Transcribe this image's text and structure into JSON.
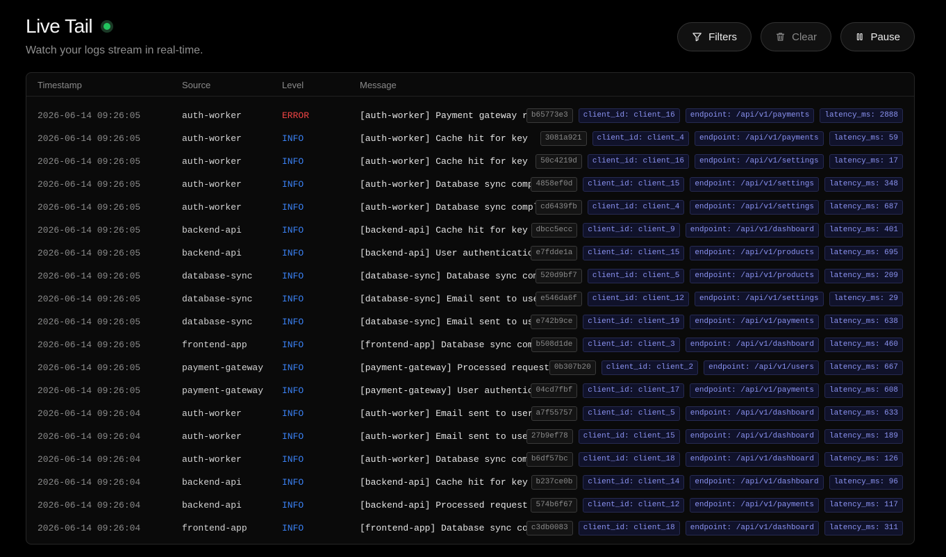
{
  "header": {
    "title": "Live Tail",
    "subtitle": "Watch your logs stream in real-time."
  },
  "actions": {
    "filters": "Filters",
    "clear": "Clear",
    "pause": "Pause"
  },
  "icons": {
    "filters": "funnel-icon",
    "clear": "trash-icon",
    "pause": "pause-icon",
    "status": "live-status-dot"
  },
  "colors": {
    "live": "#22c55e",
    "info": "#3b82f6",
    "error": "#ef4444",
    "tag": "#8b93f2"
  },
  "table": {
    "columns": [
      "Timestamp",
      "Source",
      "Level",
      "Message"
    ],
    "rows": [
      {
        "ts": "2026-06-14 09:26:05",
        "source": "auth-worker",
        "level": "ERROR",
        "message": "[auth-worker] Payment gateway rej…",
        "id": "b65773e3",
        "client": "client_id: client_16",
        "endpoint": "endpoint: /api/v1/payments",
        "latency": "latency_ms: 2888"
      },
      {
        "ts": "2026-06-14 09:26:05",
        "source": "auth-worker",
        "level": "INFO",
        "message": "[auth-worker] Cache hit for key",
        "id": "3081a921",
        "client": "client_id: client_4",
        "endpoint": "endpoint: /api/v1/payments",
        "latency": "latency_ms: 59"
      },
      {
        "ts": "2026-06-14 09:26:05",
        "source": "auth-worker",
        "level": "INFO",
        "message": "[auth-worker] Cache hit for key",
        "id": "50c4219d",
        "client": "client_id: client_16",
        "endpoint": "endpoint: /api/v1/settings",
        "latency": "latency_ms: 17"
      },
      {
        "ts": "2026-06-14 09:26:05",
        "source": "auth-worker",
        "level": "INFO",
        "message": "[auth-worker] Database sync compl…",
        "id": "4858ef0d",
        "client": "client_id: client_15",
        "endpoint": "endpoint: /api/v1/settings",
        "latency": "latency_ms: 348"
      },
      {
        "ts": "2026-06-14 09:26:05",
        "source": "auth-worker",
        "level": "INFO",
        "message": "[auth-worker] Database sync comple…",
        "id": "cd6439fb",
        "client": "client_id: client_4",
        "endpoint": "endpoint: /api/v1/settings",
        "latency": "latency_ms: 687"
      },
      {
        "ts": "2026-06-14 09:26:05",
        "source": "backend-api",
        "level": "INFO",
        "message": "[backend-api] Cache hit for key",
        "id": "dbcc5ecc",
        "client": "client_id: client_9",
        "endpoint": "endpoint: /api/v1/dashboard",
        "latency": "latency_ms: 401"
      },
      {
        "ts": "2026-06-14 09:26:05",
        "source": "backend-api",
        "level": "INFO",
        "message": "[backend-api] User authentication…",
        "id": "e7fdde1a",
        "client": "client_id: client_15",
        "endpoint": "endpoint: /api/v1/products",
        "latency": "latency_ms: 695"
      },
      {
        "ts": "2026-06-14 09:26:05",
        "source": "database-sync",
        "level": "INFO",
        "message": "[database-sync] Database sync comp…",
        "id": "520d9bf7",
        "client": "client_id: client_5",
        "endpoint": "endpoint: /api/v1/products",
        "latency": "latency_ms: 209"
      },
      {
        "ts": "2026-06-14 09:26:05",
        "source": "database-sync",
        "level": "INFO",
        "message": "[database-sync] Email sent to user",
        "id": "e546da6f",
        "client": "client_id: client_12",
        "endpoint": "endpoint: /api/v1/settings",
        "latency": "latency_ms: 29"
      },
      {
        "ts": "2026-06-14 09:26:05",
        "source": "database-sync",
        "level": "INFO",
        "message": "[database-sync] Email sent to user",
        "id": "e742b9ce",
        "client": "client_id: client_19",
        "endpoint": "endpoint: /api/v1/payments",
        "latency": "latency_ms: 638"
      },
      {
        "ts": "2026-06-14 09:26:05",
        "source": "frontend-app",
        "level": "INFO",
        "message": "[frontend-app] Database sync comp…",
        "id": "b508d1de",
        "client": "client_id: client_3",
        "endpoint": "endpoint: /api/v1/dashboard",
        "latency": "latency_ms: 460"
      },
      {
        "ts": "2026-06-14 09:26:05",
        "source": "payment-gateway",
        "level": "INFO",
        "message": "[payment-gateway] Processed request …",
        "id": "0b307b20",
        "client": "client_id: client_2",
        "endpoint": "endpoint: /api/v1/users",
        "latency": "latency_ms: 667"
      },
      {
        "ts": "2026-06-14 09:26:05",
        "source": "payment-gateway",
        "level": "INFO",
        "message": "[payment-gateway] User authentica…",
        "id": "04cd7fbf",
        "client": "client_id: client_17",
        "endpoint": "endpoint: /api/v1/payments",
        "latency": "latency_ms: 608"
      },
      {
        "ts": "2026-06-14 09:26:04",
        "source": "auth-worker",
        "level": "INFO",
        "message": "[auth-worker] Email sent to user",
        "id": "a7f55757",
        "client": "client_id: client_5",
        "endpoint": "endpoint: /api/v1/dashboard",
        "latency": "latency_ms: 633"
      },
      {
        "ts": "2026-06-14 09:26:04",
        "source": "auth-worker",
        "level": "INFO",
        "message": "[auth-worker] Email sent to user",
        "id": "27b9ef78",
        "client": "client_id: client_15",
        "endpoint": "endpoint: /api/v1/dashboard",
        "latency": "latency_ms: 189"
      },
      {
        "ts": "2026-06-14 09:26:04",
        "source": "auth-worker",
        "level": "INFO",
        "message": "[auth-worker] Database sync compl…",
        "id": "b6df57bc",
        "client": "client_id: client_18",
        "endpoint": "endpoint: /api/v1/dashboard",
        "latency": "latency_ms: 126"
      },
      {
        "ts": "2026-06-14 09:26:04",
        "source": "backend-api",
        "level": "INFO",
        "message": "[backend-api] Cache hit for key",
        "id": "b237ce0b",
        "client": "client_id: client_14",
        "endpoint": "endpoint: /api/v1/dashboard",
        "latency": "latency_ms: 96"
      },
      {
        "ts": "2026-06-14 09:26:04",
        "source": "backend-api",
        "level": "INFO",
        "message": "[backend-api] Processed request s…",
        "id": "574b6f67",
        "client": "client_id: client_12",
        "endpoint": "endpoint: /api/v1/payments",
        "latency": "latency_ms: 117"
      },
      {
        "ts": "2026-06-14 09:26:04",
        "source": "frontend-app",
        "level": "INFO",
        "message": "[frontend-app] Database sync comp…",
        "id": "c3db0083",
        "client": "client_id: client_18",
        "endpoint": "endpoint: /api/v1/dashboard",
        "latency": "latency_ms: 311"
      }
    ]
  }
}
